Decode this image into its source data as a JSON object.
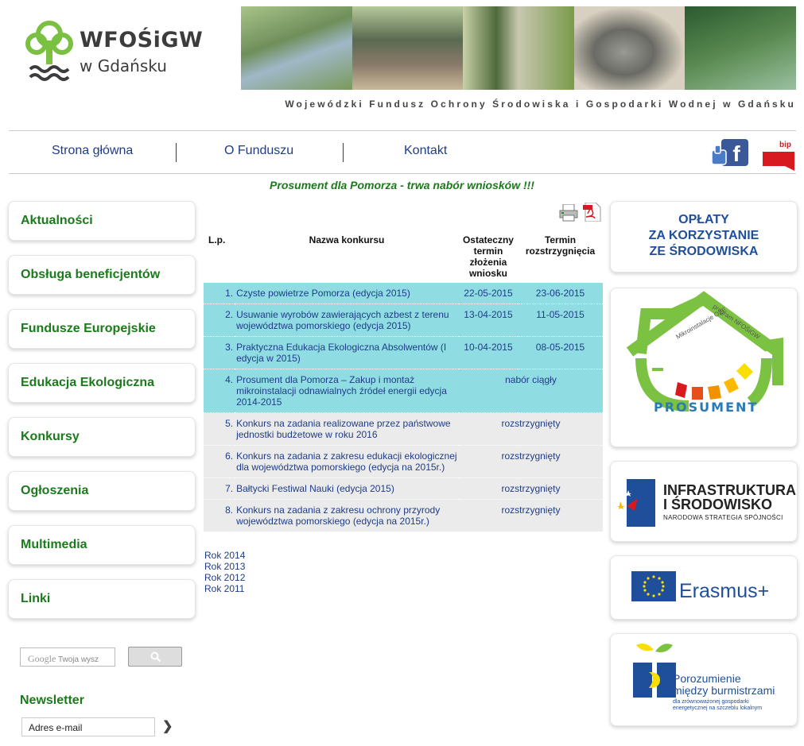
{
  "header": {
    "logo_title": "WFOŚiGW",
    "logo_subtitle": "w Gdańsku",
    "tagline": "Wojewódzki Fundusz Ochrony Środowiska i Gospodarki Wodnej w Gdańsku"
  },
  "topnav": [
    {
      "label": "Strona główna"
    },
    {
      "label": "O Funduszu"
    },
    {
      "label": "Kontakt"
    }
  ],
  "bip_label": "bip",
  "announcement": "Prosument dla Pomorza - trwa nabór wniosków !!!",
  "left_menu": [
    {
      "label": "Aktualności"
    },
    {
      "label": "Obsługa beneficjentów"
    },
    {
      "label": "Fundusze Europejskie"
    },
    {
      "label": "Edukacja Ekologiczna"
    },
    {
      "label": "Konkursy"
    },
    {
      "label": "Ogłoszenia"
    },
    {
      "label": "Multimedia"
    },
    {
      "label": "Linki"
    }
  ],
  "search": {
    "google_label": "Google",
    "placeholder": "Twoja wysz"
  },
  "newsletter": {
    "title": "Newsletter",
    "email_value": "Adres e-mail",
    "go": "❯"
  },
  "table": {
    "headers": {
      "lp": "L.p.",
      "name": "Nazwa konkursu",
      "deadline": "Ostateczny termin złożenia wniosku",
      "resolution": "Termin rozstrzygnięcia"
    },
    "rows": [
      {
        "lp": "1.",
        "name": "Czyste powietrze Pomorza (edycja 2015)",
        "deadline": "22-05-2015",
        "resolution": "23-06-2015",
        "status": ""
      },
      {
        "lp": "2.",
        "name": "Usuwanie wyrobów zawierających azbest z terenu województwa pomorskiego (edycja 2015)",
        "deadline": "13-04-2015",
        "resolution": "11-05-2015",
        "status": ""
      },
      {
        "lp": "3.",
        "name": "Praktyczna Edukacja Ekologiczna Absolwentów (I edycja w 2015)",
        "deadline": "10-04-2015",
        "resolution": "08-05-2015",
        "status": ""
      },
      {
        "lp": "4.",
        "name": "Prosument dla Pomorza – Zakup i montaż mikroinstalacji odnawialnych źródeł energii edycja 2014-2015",
        "deadline": "",
        "resolution": "",
        "status": "nabór ciągły"
      },
      {
        "lp": "5.",
        "name": "Konkurs na zadania realizowane przez państwowe jednostki budżetowe w roku 2016",
        "deadline": "",
        "resolution": "",
        "status": "rozstrzygnięty"
      },
      {
        "lp": "6.",
        "name": "Konkurs na zadania z zakresu edukacji ekologicznej dla województwa pomorskiego (edycja na 2015r.)",
        "deadline": "",
        "resolution": "",
        "status": "rozstrzygnięty"
      },
      {
        "lp": "7.",
        "name": "Bałtycki Festiwal Nauki (edycja 2015)",
        "deadline": "",
        "resolution": "",
        "status": "rozstrzygnięty"
      },
      {
        "lp": "8.",
        "name": "Konkurs na zadania z zakresu ochrony przyrody województwa pomorskiego (edycja na 2015r.)",
        "deadline": "",
        "resolution": "",
        "status": "rozstrzygnięty"
      }
    ]
  },
  "years": [
    "Rok 2014",
    "Rok 2013",
    "Rok 2012",
    "Rok 2011"
  ],
  "right_boxes": {
    "oplaty": [
      "OPŁATY",
      "ZA KORZYSTANIE",
      "ZE ŚRODOWISKA"
    ],
    "prosument": "PROSUMENT",
    "infra_title": [
      "INFRASTRUKTURA",
      "I ŚRODOWISKO"
    ],
    "infra_sub": "NARODOWA STRATEGIA SPÓJNOŚCI",
    "erasmus": "Erasmus+",
    "poro_title": [
      "Porozumienie",
      "między burmistrzami"
    ],
    "poro_sub": [
      "dla zrównoważonej gospodarki",
      "energetycznej na szczeblu lokalnym"
    ]
  },
  "colors": {
    "green": "#1b7a1b",
    "navy": "#1f3c88",
    "cyan_row": "#8fdde3",
    "grey_row": "#ebebeb"
  }
}
